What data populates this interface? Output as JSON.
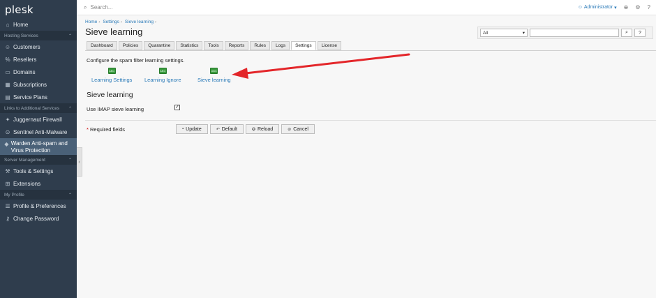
{
  "sidebar": {
    "logo": "plesk",
    "items_top": [
      {
        "label": "Home",
        "icon": "home-icon",
        "glyph": "⌂"
      }
    ],
    "sections": [
      {
        "title": "Hosting Services",
        "items": [
          {
            "label": "Customers",
            "icon": "user-icon",
            "glyph": "☺"
          },
          {
            "label": "Resellers",
            "icon": "percent-icon",
            "glyph": "%"
          },
          {
            "label": "Domains",
            "icon": "monitor-icon",
            "glyph": "▭"
          },
          {
            "label": "Subscriptions",
            "icon": "grid-icon",
            "glyph": "▦"
          },
          {
            "label": "Service Plans",
            "icon": "plan-icon",
            "glyph": "▤"
          }
        ]
      },
      {
        "title": "Links to Additional Services",
        "items": [
          {
            "label": "Juggernaut Firewall",
            "icon": "flame-icon",
            "glyph": "✦"
          },
          {
            "label": "Sentinel Anti-Malware",
            "icon": "shield-icon",
            "glyph": "⊙"
          },
          {
            "label": "Warden Anti-spam and Virus Protection",
            "icon": "warden-icon",
            "glyph": "◆",
            "active": true
          }
        ]
      },
      {
        "title": "Server Management",
        "items": [
          {
            "label": "Tools & Settings",
            "icon": "tools-icon",
            "glyph": "⚒"
          },
          {
            "label": "Extensions",
            "icon": "extensions-icon",
            "glyph": "⊞"
          }
        ]
      },
      {
        "title": "My Profile",
        "items": [
          {
            "label": "Profile & Preferences",
            "icon": "profile-icon",
            "glyph": "☰"
          },
          {
            "label": "Change Password",
            "icon": "key-icon",
            "glyph": "⚷"
          }
        ]
      }
    ]
  },
  "topbar": {
    "search_placeholder": "Search...",
    "user": "Administrator"
  },
  "breadcrumb": [
    "Home",
    "Settings",
    "Sieve learning"
  ],
  "page_title": "Sieve learning",
  "filter": {
    "selected": "All",
    "search_button": "⌕",
    "help_button": "?"
  },
  "tabs": [
    {
      "label": "Dashboard"
    },
    {
      "label": "Policies"
    },
    {
      "label": "Quarantine"
    },
    {
      "label": "Statistics"
    },
    {
      "label": "Tools"
    },
    {
      "label": "Reports"
    },
    {
      "label": "Rules"
    },
    {
      "label": "Logs"
    },
    {
      "label": "Settings",
      "active": true
    },
    {
      "label": "License"
    }
  ],
  "intro": "Configure the spam filter learning settings.",
  "tools": [
    {
      "label": "Learning Settings"
    },
    {
      "label": "Learning Ignore"
    },
    {
      "label": "Sieve learning"
    }
  ],
  "section_title": "Sieve learning",
  "form": {
    "field_label": "Use IMAP sieve learning",
    "checked": true,
    "required_text": "Required fields",
    "required_mark": "*"
  },
  "buttons": [
    {
      "label": "Update",
      "icon": "save-icon",
      "glyph": "▪"
    },
    {
      "label": "Default",
      "icon": "undo-icon",
      "glyph": "↶"
    },
    {
      "label": "Reload",
      "icon": "reload-icon",
      "glyph": "✪"
    },
    {
      "label": "Cancel",
      "icon": "cancel-icon",
      "glyph": "⊘"
    }
  ],
  "colors": {
    "sidebar": "#2f3d4d",
    "accent": "#2a7ab8",
    "arrow": "#e3262a"
  }
}
